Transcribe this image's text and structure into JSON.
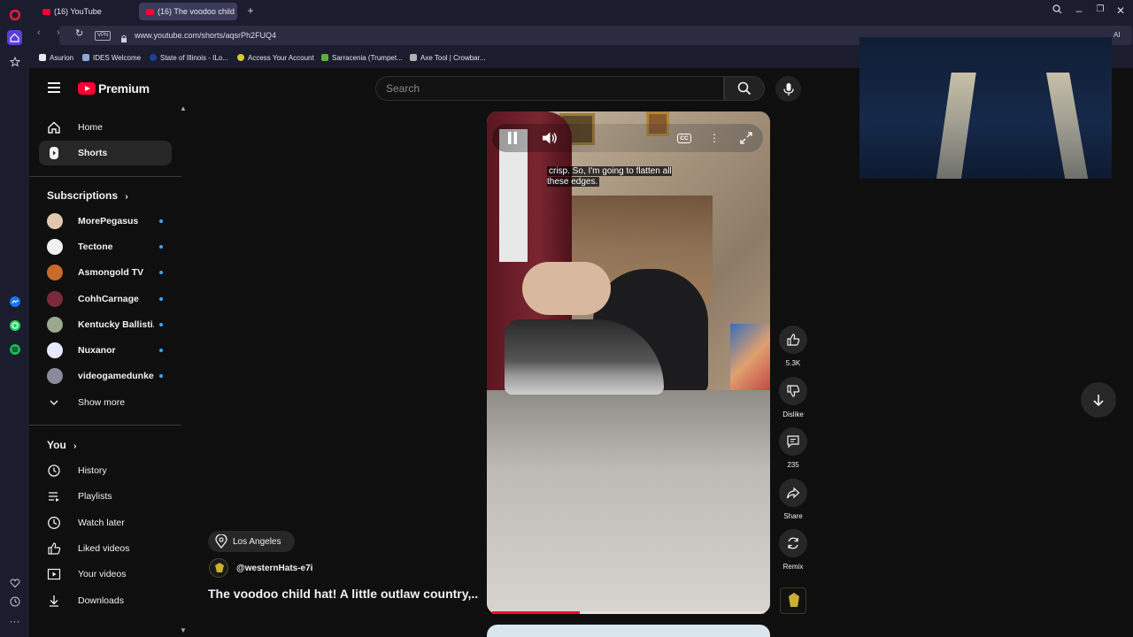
{
  "browser": {
    "tabs": [
      {
        "label": "(16) YouTube"
      },
      {
        "label": "(16) The voodoo child"
      }
    ],
    "url": "www.youtube.com/shorts/aqsrPh2FUQ4",
    "vpn_label": "VPN",
    "bookmarks": [
      {
        "label": "Asurion"
      },
      {
        "label": "IDES Welcome"
      },
      {
        "label": "State of Illinois - ILo..."
      },
      {
        "label": "Access Your Account"
      },
      {
        "label": "Sarracenia (Trumpet..."
      },
      {
        "label": "Axe Tool | Crowbar..."
      }
    ],
    "addr_right_label": "AI"
  },
  "youtube": {
    "logo_text": "Premium",
    "search_placeholder": "Search",
    "nav": [
      {
        "label": "Home",
        "icon": "home-icon"
      },
      {
        "label": "Shorts",
        "icon": "shorts-icon",
        "active": true
      }
    ],
    "subscriptions_title": "Subscriptions",
    "subscriptions": [
      {
        "label": "MorePegasus",
        "color": "#e0c8b0"
      },
      {
        "label": "Tectone",
        "color": "#f0f0f0"
      },
      {
        "label": "Asmongold TV",
        "color": "#c86a2a"
      },
      {
        "label": "CohhCarnage",
        "color": "#7a2a3a"
      },
      {
        "label": "Kentucky Ballisti...",
        "color": "#9aa890"
      },
      {
        "label": "Nuxanor",
        "color": "#e8e8ff"
      },
      {
        "label": "videogamedunkey",
        "color": "#8a8a9a"
      }
    ],
    "show_more": "Show more",
    "you_title": "You",
    "you_items": [
      {
        "label": "History"
      },
      {
        "label": "Playlists"
      },
      {
        "label": "Watch later"
      },
      {
        "label": "Liked videos"
      },
      {
        "label": "Your videos"
      },
      {
        "label": "Downloads"
      }
    ]
  },
  "short": {
    "caption": "crisp. So, I'm going to flatten all these edges.",
    "location": "Los Angeles",
    "channel": "@westernHats-e7i",
    "title": "The voodoo child hat! A little outlaw country,...",
    "progress_fraction": 0.32,
    "actions": {
      "like_count": "5.3K",
      "dislike_label": "Dislike",
      "comment_count": "235",
      "share_label": "Share",
      "remix_label": "Remix"
    },
    "cc_label": "CC"
  },
  "colors": {
    "accent": "#ff0033",
    "bg": "#0f0f0f",
    "chrome": "#1b1c2e"
  }
}
